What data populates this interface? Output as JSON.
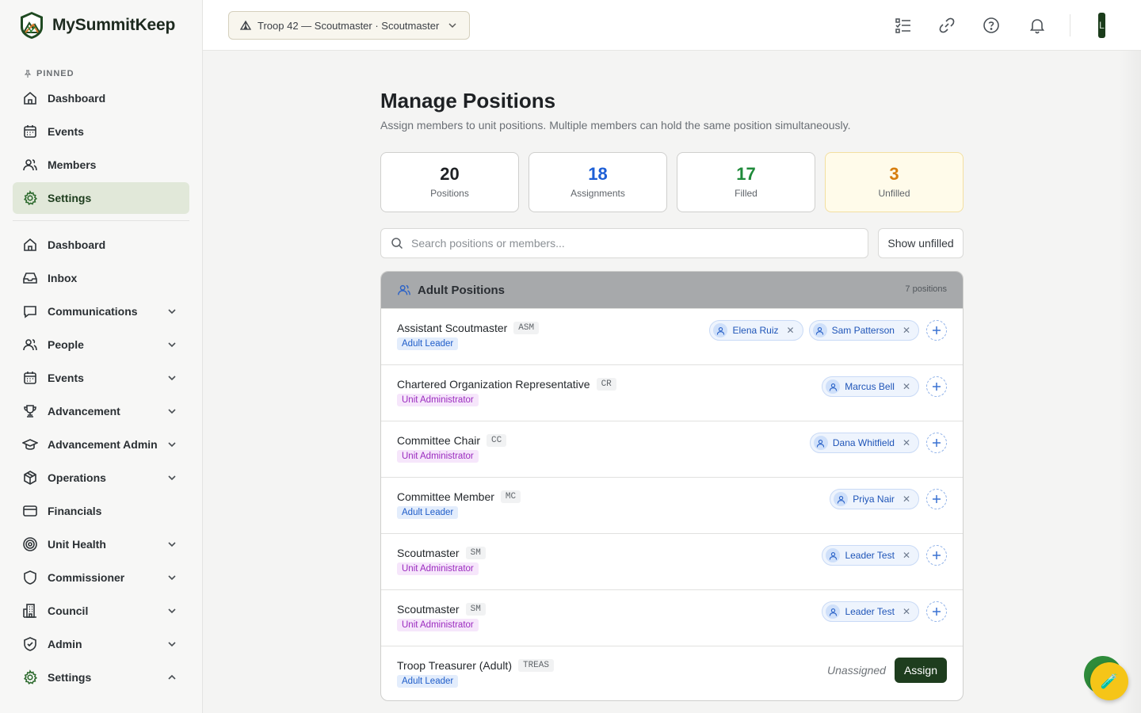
{
  "brand": {
    "name": "MySummitKeep"
  },
  "sidebar": {
    "pinned_label": "PINNED",
    "pinned": [
      {
        "label": "Dashboard",
        "icon": "home-icon"
      },
      {
        "label": "Events",
        "icon": "calendar-icon"
      },
      {
        "label": "Members",
        "icon": "users-icon"
      },
      {
        "label": "Settings",
        "icon": "gear-icon",
        "active": true
      }
    ],
    "items": [
      {
        "label": "Dashboard",
        "icon": "home-icon"
      },
      {
        "label": "Inbox",
        "icon": "inbox-icon"
      },
      {
        "label": "Communications",
        "icon": "message-icon",
        "expandable": true
      },
      {
        "label": "People",
        "icon": "users-icon",
        "expandable": true
      },
      {
        "label": "Events",
        "icon": "calendar-icon",
        "expandable": true
      },
      {
        "label": "Advancement",
        "icon": "trophy-icon",
        "expandable": true
      },
      {
        "label": "Advancement Admin",
        "icon": "graduation-cap-icon",
        "expandable": true
      },
      {
        "label": "Operations",
        "icon": "package-icon",
        "expandable": true
      },
      {
        "label": "Financials",
        "icon": "credit-card-icon"
      },
      {
        "label": "Unit Health",
        "icon": "target-icon",
        "expandable": true
      },
      {
        "label": "Commissioner",
        "icon": "shield-icon",
        "expandable": true
      },
      {
        "label": "Council",
        "icon": "building-icon",
        "expandable": true
      },
      {
        "label": "Admin",
        "icon": "shield-check-icon",
        "expandable": true
      },
      {
        "label": "Settings",
        "icon": "gear-icon",
        "expandable": true,
        "expanded": true
      }
    ]
  },
  "topbar": {
    "troop_selector": "Troop 42 — Scoutmaster · Scoutmaster",
    "user_initial": "L"
  },
  "page": {
    "title": "Manage Positions",
    "subtitle": "Assign members to unit positions. Multiple members can hold the same position simultaneously."
  },
  "stats": [
    {
      "value": "20",
      "label": "Positions"
    },
    {
      "value": "18",
      "label": "Assignments"
    },
    {
      "value": "17",
      "label": "Filled"
    },
    {
      "value": "3",
      "label": "Unfilled"
    }
  ],
  "search": {
    "placeholder": "Search positions or members..."
  },
  "filter": {
    "show_unfilled_label": "Show unfilled"
  },
  "section": {
    "title": "Adult Positions",
    "count": "7 positions",
    "rows": [
      {
        "name": "Assistant Scoutmaster",
        "abbr": "ASM",
        "tag": "Adult Leader",
        "tag_kind": "adult",
        "members": [
          "Elena Ruiz",
          "Sam Patterson"
        ]
      },
      {
        "name": "Chartered Organization Representative",
        "abbr": "CR",
        "tag": "Unit Administrator",
        "tag_kind": "admin",
        "members": [
          "Marcus Bell"
        ]
      },
      {
        "name": "Committee Chair",
        "abbr": "CC",
        "tag": "Unit Administrator",
        "tag_kind": "admin",
        "members": [
          "Dana Whitfield"
        ]
      },
      {
        "name": "Committee Member",
        "abbr": "MC",
        "tag": "Adult Leader",
        "tag_kind": "adult",
        "members": [
          "Priya Nair"
        ]
      },
      {
        "name": "Scoutmaster",
        "abbr": "SM",
        "tag": "Unit Administrator",
        "tag_kind": "admin",
        "members": [
          "Leader Test"
        ]
      },
      {
        "name": "Scoutmaster",
        "abbr": "SM",
        "tag": "Unit Administrator",
        "tag_kind": "admin",
        "members": [
          "Leader Test"
        ]
      },
      {
        "name": "Troop Treasurer (Adult)",
        "abbr": "TREAS",
        "tag": "Adult Leader",
        "tag_kind": "adult",
        "members": [],
        "unassigned_label": "Unassigned",
        "assign_label": "Assign"
      }
    ]
  },
  "colors": {
    "brand_green": "#1e3d1e",
    "accent_blue": "#1d5fd6",
    "filled_green": "#1f8a3a",
    "unfilled_orange": "#d77d0d"
  }
}
